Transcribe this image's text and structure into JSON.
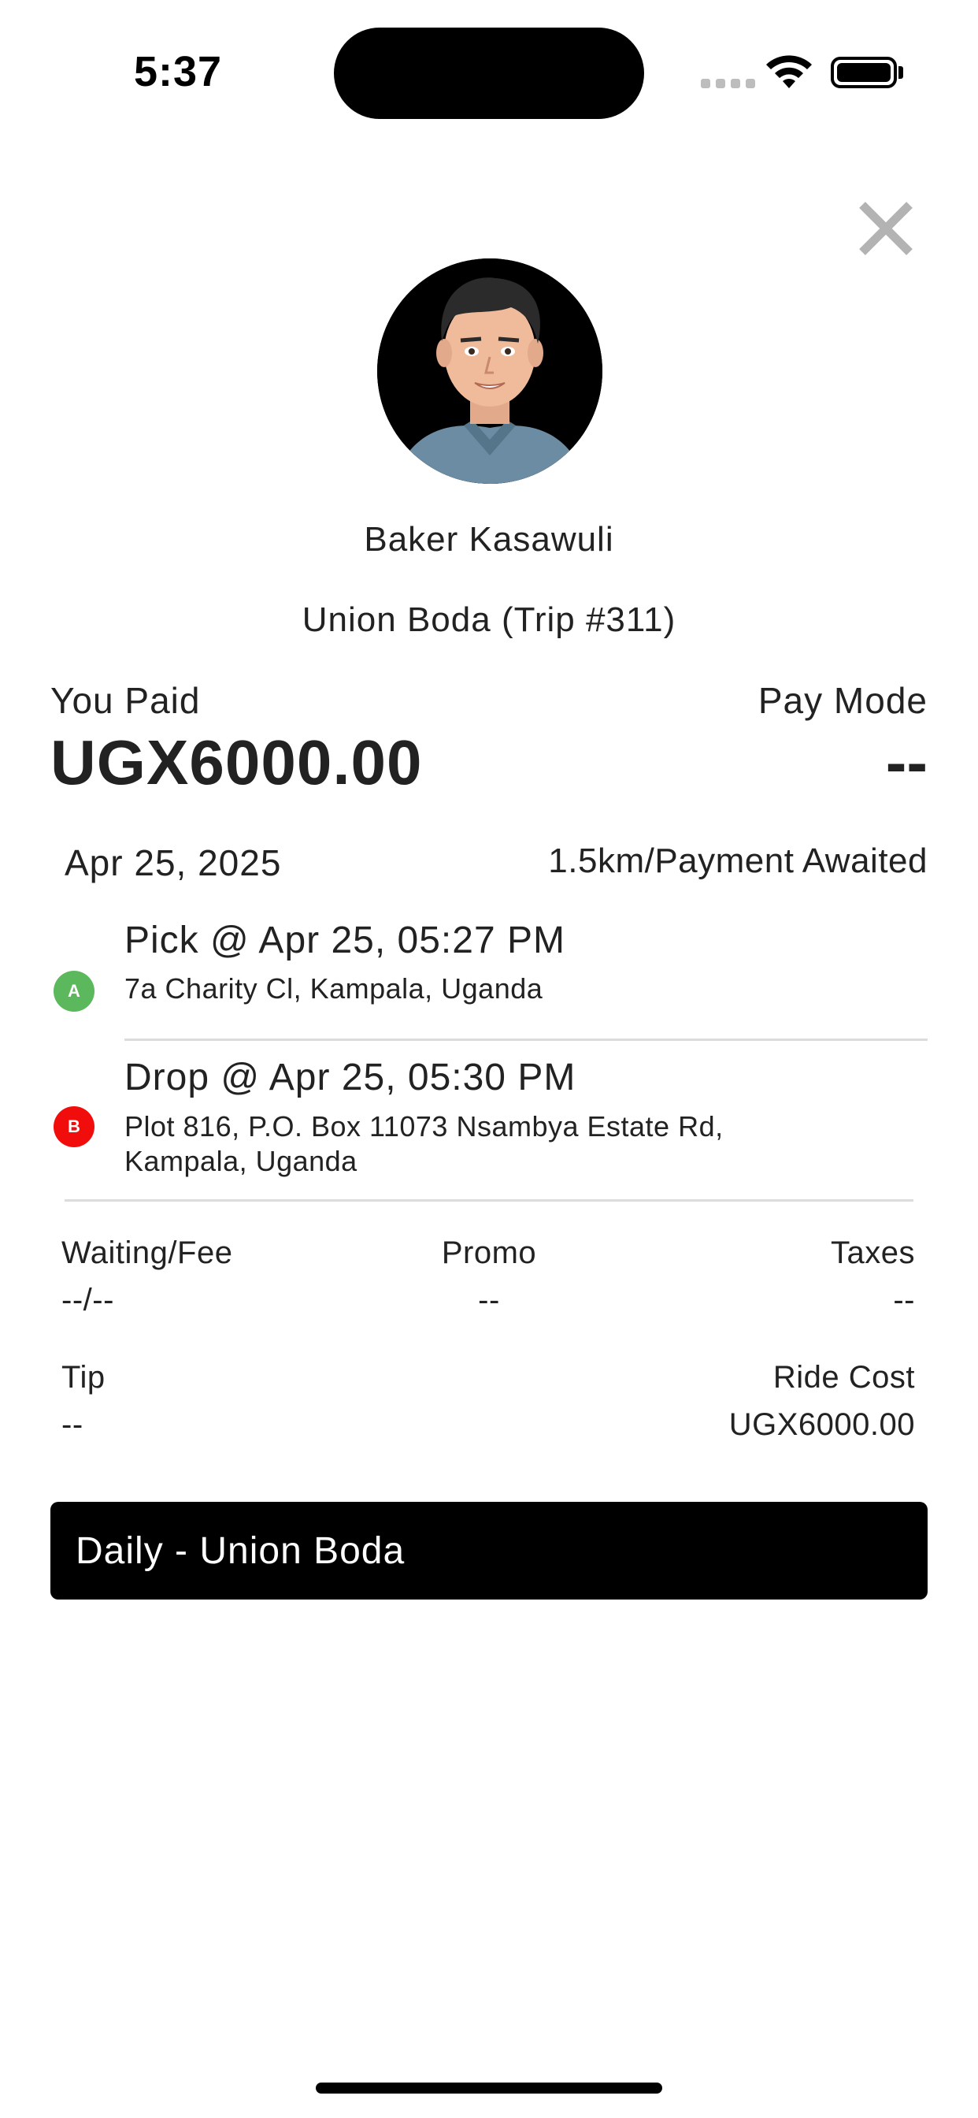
{
  "status_bar": {
    "time": "5:37"
  },
  "driver": {
    "name": "Baker Kasawuli",
    "trip_line": "Union Boda (Trip #311)"
  },
  "payment": {
    "paid_label": "You Paid",
    "paid_amount": "UGX6000.00",
    "mode_label": "Pay Mode",
    "mode_value": "--"
  },
  "trip": {
    "date": "Apr 25, 2025",
    "distance_status": "1.5km/Payment Awaited",
    "pick_marker": "A",
    "pick_time": "Pick @ Apr 25, 05:27 PM",
    "pick_address": "7a Charity Cl, Kampala, Uganda",
    "drop_marker": "B",
    "drop_time": "Drop @ Apr 25, 05:30 PM",
    "drop_address_line1": "Plot 816, P.O. Box 11073 Nsambya Estate Rd,",
    "drop_address_line2": "Kampala, Uganda"
  },
  "fees": {
    "waiting_label": "Waiting/Fee",
    "waiting_value": "--/--",
    "promo_label": "Promo",
    "promo_value": "--",
    "taxes_label": "Taxes",
    "taxes_value": "--",
    "tip_label": "Tip",
    "tip_value": "--",
    "ride_cost_label": "Ride Cost",
    "ride_cost_value": "UGX6000.00"
  },
  "plan": {
    "label": "Daily - Union Boda"
  },
  "colors": {
    "pick_marker": "#5cb85c",
    "drop_marker": "#f20d0d",
    "plan_bar": "#000000",
    "close_icon": "#b3b3b3"
  },
  "icons": {
    "close": "close-icon",
    "wifi": "wifi-icon",
    "battery": "battery-icon",
    "signal": "signal-icon"
  }
}
